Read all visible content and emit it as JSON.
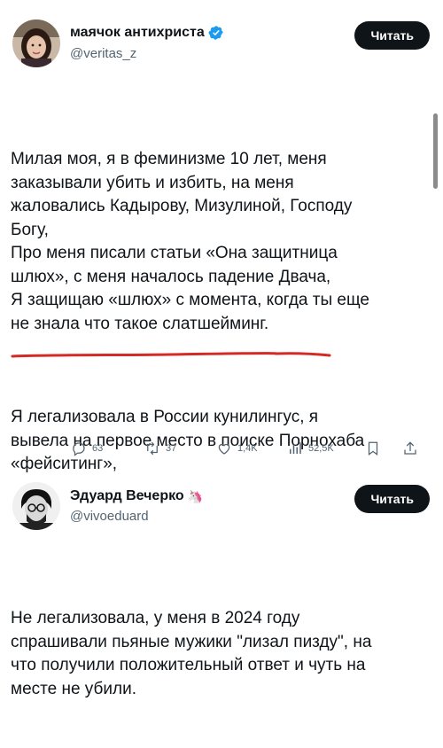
{
  "tweet1": {
    "name": "маячок антихриста",
    "handle": "@veritas_z",
    "follow_label": "Читать",
    "paragraph1": "Милая моя, я в феминизме 10 лет, меня\nзаказывали убить и избить, на меня\nжаловались Кадырову, Мизулиной, Господу\nБогу,\nПро меня писали статьи «Она защитница\nшлюх», с меня началось падение Двача,\nЯ защищаю «шлюх» с момента, когда ты еще\nне знала что такое слатшейминг.",
    "paragraph2": "Я легализовала в России кунилингус, я\nвывела на первое место в поиске Порнохаба\n«фейситинг»,",
    "stats": {
      "replies": "63",
      "retweets": "37",
      "likes": "1,4K",
      "views": "52,5K"
    }
  },
  "tweet2": {
    "name": "Эдуард Вечерко",
    "name_emoji": "🦄",
    "handle": "@vivoeduard",
    "follow_label": "Читать",
    "text": "Не легализовала, у меня в 2024 году\nспрашивали пьяные мужики \"лизал пизду\", на\nчто получили положительный ответ и чуть на\nместе не убили."
  },
  "colors": {
    "verified": "#1d9bf0",
    "muted_text": "#536471",
    "button_bg": "#0f1419",
    "underline": "#d42a25"
  }
}
